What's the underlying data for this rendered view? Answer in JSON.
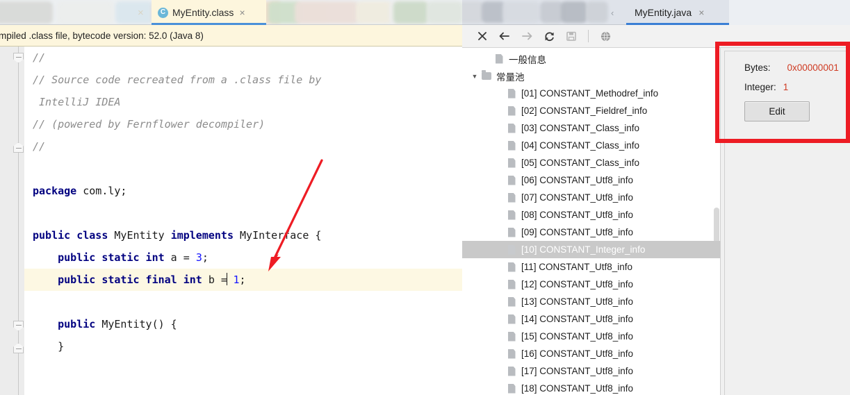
{
  "editor": {
    "tabs": [
      {
        "label": "MyEntity.class",
        "icon": "java-class-icon",
        "active": true,
        "close": "×"
      }
    ],
    "banner_text": "mpiled .class file, bytecode version: 52.0 (Java 8)",
    "lines": [
      {
        "indent": 0,
        "tokens": [
          {
            "t": "cmt",
            "s": "//"
          }
        ]
      },
      {
        "indent": 0,
        "tokens": [
          {
            "t": "cmt",
            "s": "// Source code recreated from a .class file by"
          }
        ]
      },
      {
        "indent": 0,
        "tokens": [
          {
            "t": "cmt",
            "s": " IntelliJ IDEA"
          }
        ]
      },
      {
        "indent": 0,
        "tokens": [
          {
            "t": "cmt",
            "s": "// (powered by Fernflower decompiler)"
          }
        ]
      },
      {
        "indent": 0,
        "tokens": [
          {
            "t": "cmt",
            "s": "//"
          }
        ]
      },
      {
        "indent": 0,
        "tokens": []
      },
      {
        "indent": 0,
        "tokens": [
          {
            "t": "kw",
            "s": "package"
          },
          {
            "t": "plain",
            "s": " com.ly;"
          }
        ]
      },
      {
        "indent": 0,
        "tokens": []
      },
      {
        "indent": 0,
        "tokens": [
          {
            "t": "kw",
            "s": "public class"
          },
          {
            "t": "plain",
            "s": " MyEntity "
          },
          {
            "t": "kw",
            "s": "implements"
          },
          {
            "t": "plain",
            "s": " MyInterface {"
          }
        ]
      },
      {
        "indent": 0,
        "tokens": [
          {
            "t": "plain",
            "s": "    "
          },
          {
            "t": "kw",
            "s": "public static int"
          },
          {
            "t": "plain",
            "s": " a = "
          },
          {
            "t": "num",
            "s": "3"
          },
          {
            "t": "plain",
            "s": ";"
          }
        ]
      },
      {
        "indent": 0,
        "highlight": true,
        "tokens": [
          {
            "t": "plain",
            "s": "    "
          },
          {
            "t": "kw",
            "s": "public static final int"
          },
          {
            "t": "plain",
            "s": " b ="
          },
          {
            "t": "caret",
            "s": ""
          },
          {
            "t": "plain",
            "s": " "
          },
          {
            "t": "num",
            "s": "1"
          },
          {
            "t": "plain",
            "s": ";"
          }
        ]
      },
      {
        "indent": 0,
        "tokens": []
      },
      {
        "indent": 0,
        "tokens": [
          {
            "t": "plain",
            "s": "    "
          },
          {
            "t": "kw",
            "s": "public"
          },
          {
            "t": "plain",
            "s": " MyEntity() {"
          }
        ]
      },
      {
        "indent": 0,
        "tokens": [
          {
            "t": "plain",
            "s": "    }"
          }
        ]
      },
      {
        "indent": 0,
        "tokens": []
      }
    ],
    "annotation": {
      "type": "red-arrow",
      "color": "#ee1c24",
      "points_at": "3;"
    }
  },
  "right_panel": {
    "tabs": [
      {
        "label": "MyEntity.java",
        "active": true,
        "close": "×"
      }
    ],
    "toolbar": [
      {
        "name": "close-icon",
        "glyph": "×",
        "enabled": true
      },
      {
        "name": "back-arrow-icon",
        "glyph": "←",
        "enabled": true
      },
      {
        "name": "forward-arrow-icon",
        "glyph": "→",
        "enabled": false
      },
      {
        "name": "refresh-icon",
        "glyph": "↻",
        "enabled": true
      },
      {
        "name": "save-icon",
        "glyph": "Ὃe",
        "enabled": false
      },
      {
        "name": "globe-icon",
        "glyph": "ἱ0",
        "enabled": true
      }
    ],
    "tree": [
      {
        "level": 1,
        "icon": "file-icon",
        "label": "一般信息",
        "expandable": false,
        "selected": false
      },
      {
        "level": 0,
        "icon": "folder-icon",
        "label": "常量池",
        "expandable": true,
        "expanded": true,
        "selected": false
      },
      {
        "level": 2,
        "icon": "file-icon",
        "label": "[01] CONSTANT_Methodref_info",
        "selected": false
      },
      {
        "level": 2,
        "icon": "file-icon",
        "label": "[02] CONSTANT_Fieldref_info",
        "selected": false
      },
      {
        "level": 2,
        "icon": "file-icon",
        "label": "[03] CONSTANT_Class_info",
        "selected": false
      },
      {
        "level": 2,
        "icon": "file-icon",
        "label": "[04] CONSTANT_Class_info",
        "selected": false
      },
      {
        "level": 2,
        "icon": "file-icon",
        "label": "[05] CONSTANT_Class_info",
        "selected": false
      },
      {
        "level": 2,
        "icon": "file-icon",
        "label": "[06] CONSTANT_Utf8_info",
        "selected": false
      },
      {
        "level": 2,
        "icon": "file-icon",
        "label": "[07] CONSTANT_Utf8_info",
        "selected": false
      },
      {
        "level": 2,
        "icon": "file-icon",
        "label": "[08] CONSTANT_Utf8_info",
        "selected": false
      },
      {
        "level": 2,
        "icon": "file-icon",
        "label": "[09] CONSTANT_Utf8_info",
        "selected": false
      },
      {
        "level": 2,
        "icon": "file-icon",
        "label": "[10] CONSTANT_Integer_info",
        "selected": true
      },
      {
        "level": 2,
        "icon": "file-icon",
        "label": "[11] CONSTANT_Utf8_info",
        "selected": false
      },
      {
        "level": 2,
        "icon": "file-icon",
        "label": "[12] CONSTANT_Utf8_info",
        "selected": false
      },
      {
        "level": 2,
        "icon": "file-icon",
        "label": "[13] CONSTANT_Utf8_info",
        "selected": false
      },
      {
        "level": 2,
        "icon": "file-icon",
        "label": "[14] CONSTANT_Utf8_info",
        "selected": false
      },
      {
        "level": 2,
        "icon": "file-icon",
        "label": "[15] CONSTANT_Utf8_info",
        "selected": false
      },
      {
        "level": 2,
        "icon": "file-icon",
        "label": "[16] CONSTANT_Utf8_info",
        "selected": false
      },
      {
        "level": 2,
        "icon": "file-icon",
        "label": "[17] CONSTANT_Utf8_info",
        "selected": false
      },
      {
        "level": 2,
        "icon": "file-icon",
        "label": "[18] CONSTANT_Utf8_info",
        "selected": false
      }
    ],
    "detail": {
      "bytes_label": "Bytes:",
      "bytes_value": "0x00000001",
      "integer_label": "Integer:",
      "integer_value": "1",
      "edit_label": "Edit",
      "value_color": "#cf3a22",
      "highlight_color": "#ed1c24"
    }
  }
}
